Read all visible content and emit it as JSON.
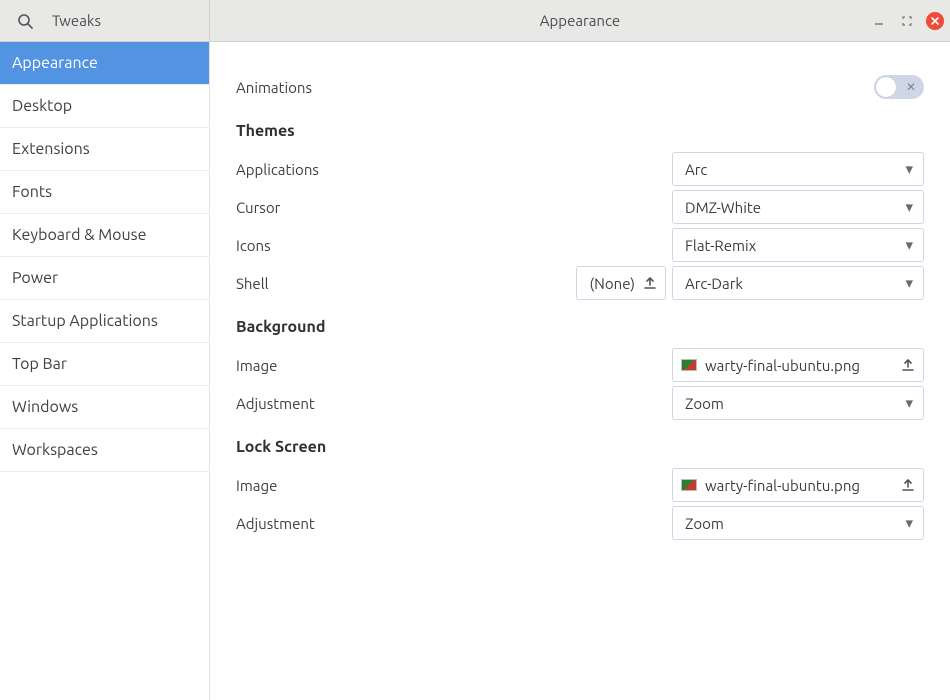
{
  "header": {
    "app_title": "Tweaks",
    "page_title": "Appearance"
  },
  "sidebar": {
    "items": [
      {
        "label": "Appearance",
        "selected": true
      },
      {
        "label": "Desktop"
      },
      {
        "label": "Extensions"
      },
      {
        "label": "Fonts"
      },
      {
        "label": "Keyboard & Mouse"
      },
      {
        "label": "Power"
      },
      {
        "label": "Startup Applications"
      },
      {
        "label": "Top Bar"
      },
      {
        "label": "Windows"
      },
      {
        "label": "Workspaces"
      }
    ]
  },
  "main": {
    "animations_label": "Animations",
    "animations_on": false,
    "sections": {
      "themes": {
        "title": "Themes",
        "applications": {
          "label": "Applications",
          "value": "Arc"
        },
        "cursor": {
          "label": "Cursor",
          "value": "DMZ-White"
        },
        "icons": {
          "label": "Icons",
          "value": "Flat-Remix"
        },
        "shell": {
          "label": "Shell",
          "upload_value": "(None)",
          "value": "Arc-Dark"
        }
      },
      "background": {
        "title": "Background",
        "image": {
          "label": "Image",
          "value": "warty-final-ubuntu.png"
        },
        "adjustment": {
          "label": "Adjustment",
          "value": "Zoom"
        }
      },
      "lockscreen": {
        "title": "Lock Screen",
        "image": {
          "label": "Image",
          "value": "warty-final-ubuntu.png"
        },
        "adjustment": {
          "label": "Adjustment",
          "value": "Zoom"
        }
      }
    }
  }
}
